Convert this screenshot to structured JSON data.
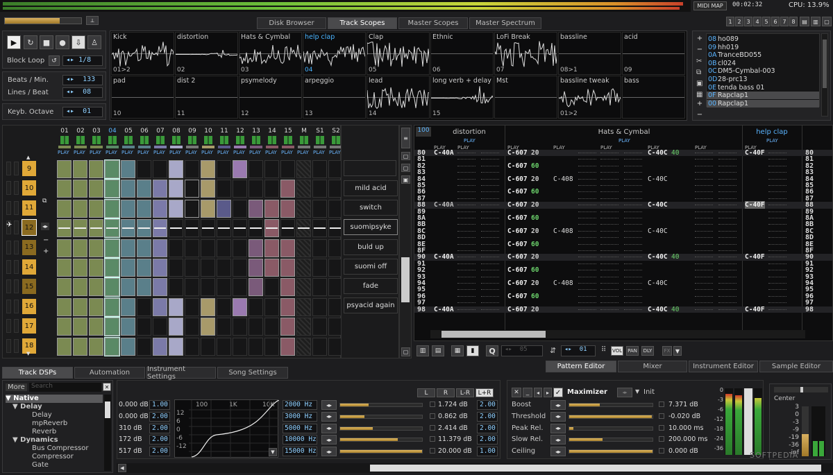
{
  "topbar": {
    "midi_map": "MIDI MAP",
    "time": "00:02:32",
    "cpu": "CPU: 13.9%"
  },
  "upper_tabs": [
    "Disk Browser",
    "Track Scopes",
    "Master Scopes",
    "Master Spectrum"
  ],
  "transport": {
    "block_loop_label": "Block Loop",
    "block_loop_value": "1/8",
    "bpm_label": "Beats / Min.",
    "bpm_value": "133",
    "lpb_label": "Lines / Beat",
    "lpb_value": "08",
    "octave_label": "Keyb. Octave",
    "octave_value": "01"
  },
  "scopes": [
    {
      "name": "Kick",
      "num": "01>2",
      "sel": false
    },
    {
      "name": "distortion",
      "num": "02",
      "sel": false
    },
    {
      "name": "Hats & Cymbal",
      "num": "03",
      "sel": false
    },
    {
      "name": "help clap",
      "num": "04",
      "sel": true
    },
    {
      "name": "Clap",
      "num": "05",
      "sel": false
    },
    {
      "name": "Ethnic",
      "num": "06",
      "sel": false
    },
    {
      "name": "LoFi Break",
      "num": "07",
      "sel": false
    },
    {
      "name": "bassline",
      "num": "08>1",
      "sel": false
    },
    {
      "name": "acid",
      "num": "09",
      "sel": false
    },
    {
      "name": "pad",
      "num": "10",
      "sel": false
    },
    {
      "name": "dist 2",
      "num": "11",
      "sel": false
    },
    {
      "name": "psymelody",
      "num": "12",
      "sel": false
    },
    {
      "name": "arpeggio",
      "num": "13",
      "sel": false
    },
    {
      "name": "lead",
      "num": "14",
      "sel": false
    },
    {
      "name": "long verb + delay",
      "num": "15",
      "sel": false
    },
    {
      "name": "Mst",
      "num": "",
      "sel": false
    },
    {
      "name": "bassline tweak",
      "num": "01>2",
      "sel": false
    },
    {
      "name": "bass",
      "num": "",
      "sel": false
    }
  ],
  "instruments": [
    {
      "idx": "08",
      "name": "ho089"
    },
    {
      "idx": "09",
      "name": "hh019"
    },
    {
      "idx": "0A",
      "name": "TranceBD055"
    },
    {
      "idx": "0B",
      "name": "cl024"
    },
    {
      "idx": "0C",
      "name": "DM5-Cymbal-003"
    },
    {
      "idx": "0D",
      "name": "28-prc13"
    },
    {
      "idx": "0E",
      "name": "tenda bass 01"
    },
    {
      "idx": "0F",
      "name": "Rapclap1"
    },
    {
      "idx": "00",
      "name": "Rapclap1"
    }
  ],
  "matrix": {
    "tracks": [
      "01",
      "02",
      "03",
      "04",
      "05",
      "06",
      "07",
      "08",
      "09",
      "10",
      "11",
      "12",
      "13",
      "14",
      "15",
      "M",
      "S1",
      "S2"
    ],
    "play_label": "PLAY",
    "sequence": [
      "9",
      "10",
      "11",
      "12",
      "13",
      "14",
      "15",
      "16",
      "17",
      "18"
    ]
  },
  "sections": [
    "mild acid",
    "switch",
    "suomipsyke",
    "buld up",
    "suomi off",
    "fade",
    "psyacid again"
  ],
  "pattern": {
    "header_num": "100",
    "track_names": [
      "distortion",
      "Hats & Cymbal",
      "help clap"
    ],
    "rows": [
      "80",
      "81",
      "82",
      "83",
      "84",
      "85",
      "86",
      "87",
      "88",
      "89",
      "8A",
      "8B",
      "8C",
      "8D",
      "8E",
      "8F",
      "90",
      "91",
      "92",
      "93",
      "94",
      "95",
      "96",
      "97",
      "98"
    ],
    "note_a": "C-40A",
    "note_607": "C-607",
    "vol20": "20",
    "vol60": "60",
    "note_408": "C-408",
    "note_40c": "C-40C",
    "vol40": "40",
    "note_4f": "C-40F",
    "bottom_num": "05",
    "bottom_num2": "01",
    "vol": "VOL",
    "pan": "PAN",
    "dly": "DLY",
    "fx": "FX"
  },
  "lower_tabs_left": [
    "Track DSPs",
    "Automation",
    "Instrument Settings",
    "Song Settings"
  ],
  "lower_tabs_right": [
    "Pattern Editor",
    "Mixer",
    "Instrument Editor",
    "Sample Editor"
  ],
  "dsp_tree": {
    "more": "More",
    "search": "Search",
    "items": [
      "Native",
      "Delay",
      "Delay",
      "mpReverb",
      "Reverb",
      "Dynamics",
      "Bus Compressor",
      "Compressor",
      "Gate"
    ]
  },
  "eq": {
    "gains": [
      "0.000 dB",
      "0.000 dB",
      "310 dB",
      "172 dB",
      "517 dB"
    ],
    "qs": [
      "1.00",
      "2.00",
      "2.00",
      "2.00",
      "2.00"
    ],
    "freqs": [
      "2000 Hz",
      "3000 Hz",
      "5000 Hz",
      "10000 Hz",
      "15000 Hz"
    ],
    "graph_labels": [
      "100",
      "1K",
      "10K"
    ],
    "graph_ylabels": [
      "12",
      "6",
      "0",
      "-6",
      "-12"
    ],
    "right_vals": [
      "1.724 dB",
      "0.862 dB",
      "2.414 dB",
      "11.379 dB",
      "20.000 dB"
    ],
    "right_qs": [
      "2.00",
      "2.00",
      "2.00",
      "2.00",
      "1.00"
    ],
    "right_fills": [
      0.35,
      0.3,
      0.4,
      0.7,
      1.0
    ],
    "chan": [
      "L",
      "R",
      "L-R",
      "L+R"
    ]
  },
  "maximizer": {
    "title": "Maximizer",
    "init": "Init",
    "params": [
      {
        "label": "Boost",
        "value": "7.371 dB",
        "fill": 0.37
      },
      {
        "label": "Threshold",
        "value": "-0.020 dB",
        "fill": 0.99
      },
      {
        "label": "Peak Rel.",
        "value": "10.000 ms",
        "fill": 0.05
      },
      {
        "label": "Slow Rel.",
        "value": "200.000 ms",
        "fill": 0.4
      },
      {
        "label": "Ceiling",
        "value": "0.000 dB",
        "fill": 1.0
      }
    ]
  },
  "meter": {
    "labels": [
      "0",
      "-3",
      "-6",
      "-12",
      "-18",
      "-24",
      "-36"
    ],
    "center": "Center",
    "scale": [
      "3",
      "0",
      "-3",
      "-9",
      "-19",
      "-36",
      "-inf"
    ]
  },
  "watermark": "SOFTPEDIA"
}
